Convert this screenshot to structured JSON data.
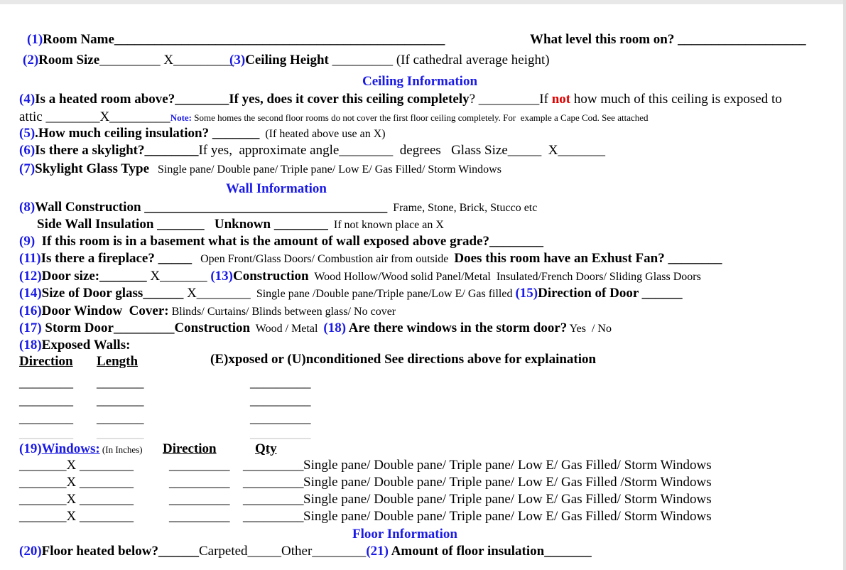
{
  "colors": {
    "label_number": "#1a1ae6",
    "heading": "#1a1ae6",
    "emphasis": "#e00000"
  },
  "lines": [
    {
      "name": "room-name-line",
      "segs": [
        [
          "n",
          "(1)"
        ],
        [
          "b",
          "Room Name_________________________________________________"
        ]
      ]
    },
    {
      "name": "room-level-line",
      "segs": [
        [
          "b",
          "What level this room on? ___________________"
        ]
      ]
    },
    {
      "name": "room-size-line",
      "segs": [
        [
          "n",
          "(2)"
        ],
        [
          "b",
          "Room Size"
        ],
        [
          "r",
          "_________ X_________"
        ]
      ]
    },
    {
      "name": "ceiling-height-line",
      "segs": [
        [
          "n",
          "(3)"
        ],
        [
          "b",
          "Ceiling Height"
        ],
        [
          "r",
          " _________ (If cathedral average height)"
        ]
      ]
    },
    {
      "name": "ceiling-information-heading",
      "segs": [
        [
          "h",
          "Ceiling Information"
        ]
      ]
    },
    {
      "name": "heated-room-above-line",
      "segs": [
        [
          "n",
          "(4)"
        ],
        [
          "b",
          "Is a heated room above?________If yes, does it cover this ceiling completely"
        ],
        [
          "r",
          "? _________If "
        ],
        [
          "red",
          "not"
        ],
        [
          "r",
          " how much of this ceiling is exposed to"
        ]
      ]
    },
    {
      "name": "attic-line",
      "segs": [
        [
          "r",
          "attic ________X_________"
        ],
        [
          "ns",
          "Note:"
        ],
        [
          "s",
          " Some homes the second floor rooms do not cover the first floor ceiling completely. For  example a Cape Cod. See attached"
        ]
      ]
    },
    {
      "name": "ceiling-insulation-line",
      "segs": [
        [
          "n",
          "(5)"
        ],
        [
          "b",
          ".How much ceiling insulation? _______"
        ],
        [
          "r2",
          "  (If heated above use an X)"
        ]
      ]
    },
    {
      "name": "skylight-line",
      "segs": [
        [
          "n",
          "(6)"
        ],
        [
          "b",
          "Is there a skylight?________"
        ],
        [
          "r",
          "If yes,  approximate angle________  degrees   Glass Size_____  X_______"
        ]
      ]
    },
    {
      "name": "skylight-glass-type-line",
      "segs": [
        [
          "n",
          "(7)"
        ],
        [
          "b",
          "Skylight Glass Type"
        ],
        [
          "r2",
          "   Single pane/ Double pane/ Triple pane/ Low E/ Gas Filled/ Storm Windows"
        ]
      ]
    },
    {
      "name": "wall-information-heading",
      "segs": [
        [
          "h",
          "Wall Information"
        ]
      ]
    },
    {
      "name": "wall-construction-line",
      "segs": [
        [
          "n",
          "(8)"
        ],
        [
          "b",
          "Wall Construction ____________________________________"
        ],
        [
          "r2",
          "  Frame, Stone, Brick, Stucco etc"
        ]
      ]
    },
    {
      "name": "side-wall-insulation-line",
      "segs": [
        [
          "b",
          "Side Wall Insulation _______   Unknown ________"
        ],
        [
          "r2",
          "  If not known place an X"
        ]
      ]
    },
    {
      "name": "basement-wall-line",
      "segs": [
        [
          "n",
          "(9)"
        ],
        [
          "b",
          "  If this room is in a basement what is the amount of wall exposed above grade?________"
        ]
      ]
    },
    {
      "name": "fireplace-line",
      "segs": [
        [
          "n",
          "(11)"
        ],
        [
          "b",
          "Is there a fireplace? _____"
        ],
        [
          "r2",
          "   Open Front/Glass Doors/ Combustion air from outside  "
        ],
        [
          "b",
          "Does this room have an Exhust Fan? ________"
        ]
      ]
    },
    {
      "name": "door-size-line",
      "segs": [
        [
          "n",
          "(12)"
        ],
        [
          "b",
          "Door size:_______"
        ],
        [
          "r",
          " X_______ "
        ],
        [
          "n",
          "(13)"
        ],
        [
          "b",
          "Construction"
        ],
        [
          "r2",
          "  Wood Hollow/Wood solid Panel/Metal  Insulated/French Doors/ Sliding Glass Doors"
        ]
      ]
    },
    {
      "name": "door-glass-line",
      "segs": [
        [
          "n",
          "(14)"
        ],
        [
          "b",
          "Size of Door glass______"
        ],
        [
          "r",
          " X________"
        ],
        [
          "r2",
          "  Single pane /Double pane/Triple pane/Low E/ Gas filled "
        ],
        [
          "n",
          "(15)"
        ],
        [
          "b",
          "Direction of Door ______"
        ]
      ]
    },
    {
      "name": "door-window-cover-line",
      "segs": [
        [
          "n",
          "(16)"
        ],
        [
          "b",
          "Door Window  Cover:"
        ],
        [
          "r2",
          " Blinds/ Curtains/ Blinds between glass/ No cover"
        ]
      ]
    },
    {
      "name": "storm-door-line",
      "segs": [
        [
          "n",
          "(17)"
        ],
        [
          "b",
          " Storm Door_________Construction"
        ],
        [
          "r2",
          "  Wood / Metal  "
        ],
        [
          "n",
          "(18)"
        ],
        [
          "b",
          " Are there windows in the storm door?"
        ],
        [
          "r2",
          " Yes  / No"
        ]
      ]
    },
    {
      "name": "exposed-walls-line",
      "segs": [
        [
          "n",
          "(18)"
        ],
        [
          "b",
          "Exposed Walls:"
        ]
      ]
    },
    {
      "name": "direction-header",
      "segs": [
        [
          "u",
          "Direction"
        ]
      ]
    },
    {
      "name": "length-header",
      "segs": [
        [
          "u",
          "Length"
        ]
      ]
    },
    {
      "name": "exposed-header",
      "segs": [
        [
          "b",
          "(E)xposed or (U)nconditioned See directions above for explaination"
        ]
      ]
    },
    {
      "name": "windows-line",
      "segs": [
        [
          "n",
          "(19)"
        ],
        [
          "nu",
          "Windows:"
        ],
        [
          "s",
          " (In Inches) "
        ]
      ]
    },
    {
      "name": "window-direction-header",
      "segs": [
        [
          "u",
          "Direction"
        ]
      ]
    },
    {
      "name": "window-qty-header",
      "segs": [
        [
          "u",
          "Qty"
        ]
      ]
    },
    {
      "name": "floor-information-heading",
      "segs": [
        [
          "h",
          "Floor Information"
        ]
      ]
    },
    {
      "name": "floor-line",
      "segs": [
        [
          "n",
          "(20)"
        ],
        [
          "b",
          "Floor heated below?______"
        ],
        [
          "r",
          "Carpeted_____Other________"
        ],
        [
          "n",
          "(21)"
        ],
        [
          "b",
          " Amount of floor insulation_______"
        ]
      ]
    }
  ],
  "exposed_wall_rows": [
    [
      "________",
      "_______",
      "_________"
    ],
    [
      "________",
      "_______",
      "_________"
    ],
    [
      "________",
      "_______",
      "_________"
    ],
    [
      "________",
      "_______",
      "_________"
    ]
  ],
  "window_rows": [
    [
      "_______X ________",
      "_________",
      "_________",
      "Single pane/ Double pane/ Triple pane/ Low E/ Gas Filled/ Storm Windows"
    ],
    [
      "_______X ________",
      "_________",
      "_________",
      "Single pane/ Double pane/ Triple pane/ Low E/ Gas Filled /Storm Windows"
    ],
    [
      "_______X ________",
      "_________",
      "_________",
      "Single pane/ Double pane/ Triple pane/ Low E/ Gas Filled/ Storm Windows"
    ],
    [
      "_______X ________",
      "_________",
      "_________",
      "Single pane/ Double pane/ Triple pane/ Low E/ Gas Filled/ Storm Windows"
    ]
  ]
}
